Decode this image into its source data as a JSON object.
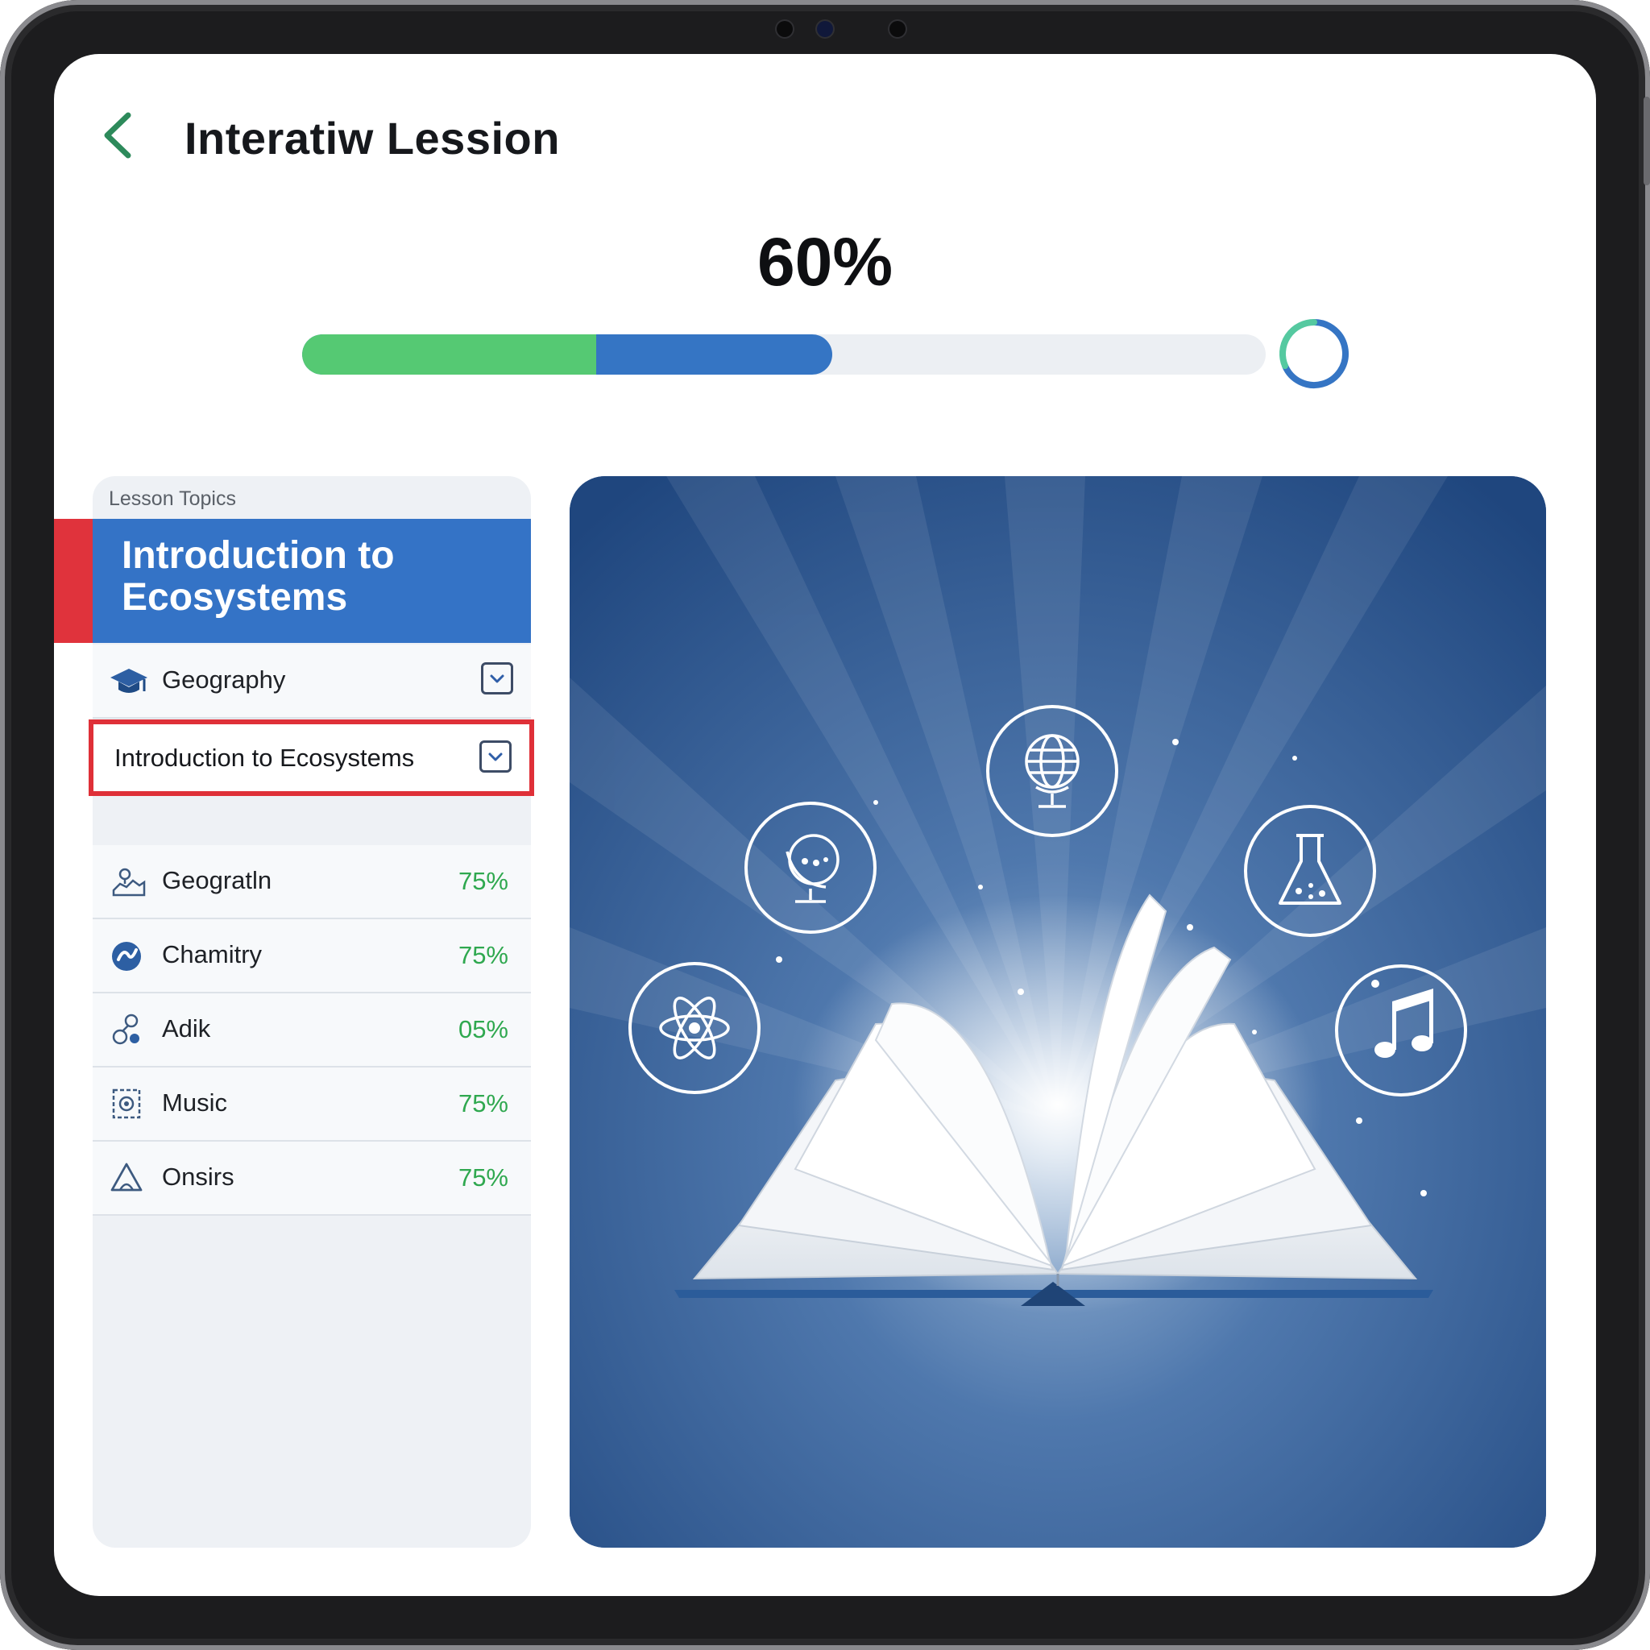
{
  "app": {
    "title": "Interatiw Lession"
  },
  "progress": {
    "percent_label": "60%",
    "total_fraction": 0.55,
    "green_fraction": 0.305,
    "colors": {
      "green": "#55c973",
      "blue": "#3575c4",
      "track": "#eceff3"
    }
  },
  "sidebar": {
    "section_label": "Lesson Topics",
    "active_topic": {
      "line1": "Introduction to",
      "line2": "Ecosystems"
    },
    "first_row": {
      "label": "Geography",
      "icon": "graduation-cap-icon"
    },
    "selected_row": {
      "label": "Introduction to Ecosystems"
    },
    "topics": [
      {
        "label": "Geogratln",
        "value": "75%",
        "icon": "map-icon"
      },
      {
        "label": "Chamitry",
        "value": "75%",
        "icon": "globe-swirl-icon"
      },
      {
        "label": "Adik",
        "value": "05%",
        "icon": "molecule-icon"
      },
      {
        "label": "Music",
        "value": "75%",
        "icon": "gear-frame-icon"
      },
      {
        "label": "Onsirs",
        "value": "75%",
        "icon": "triangle-icon"
      }
    ]
  },
  "hero": {
    "icons": [
      "globe-icon",
      "globe-stand-icon",
      "flask-icon",
      "atom-icon",
      "music-note-icon",
      "open-book-icon"
    ],
    "colors": {
      "background": "#264f8a",
      "highlight": "#ffffff"
    }
  }
}
